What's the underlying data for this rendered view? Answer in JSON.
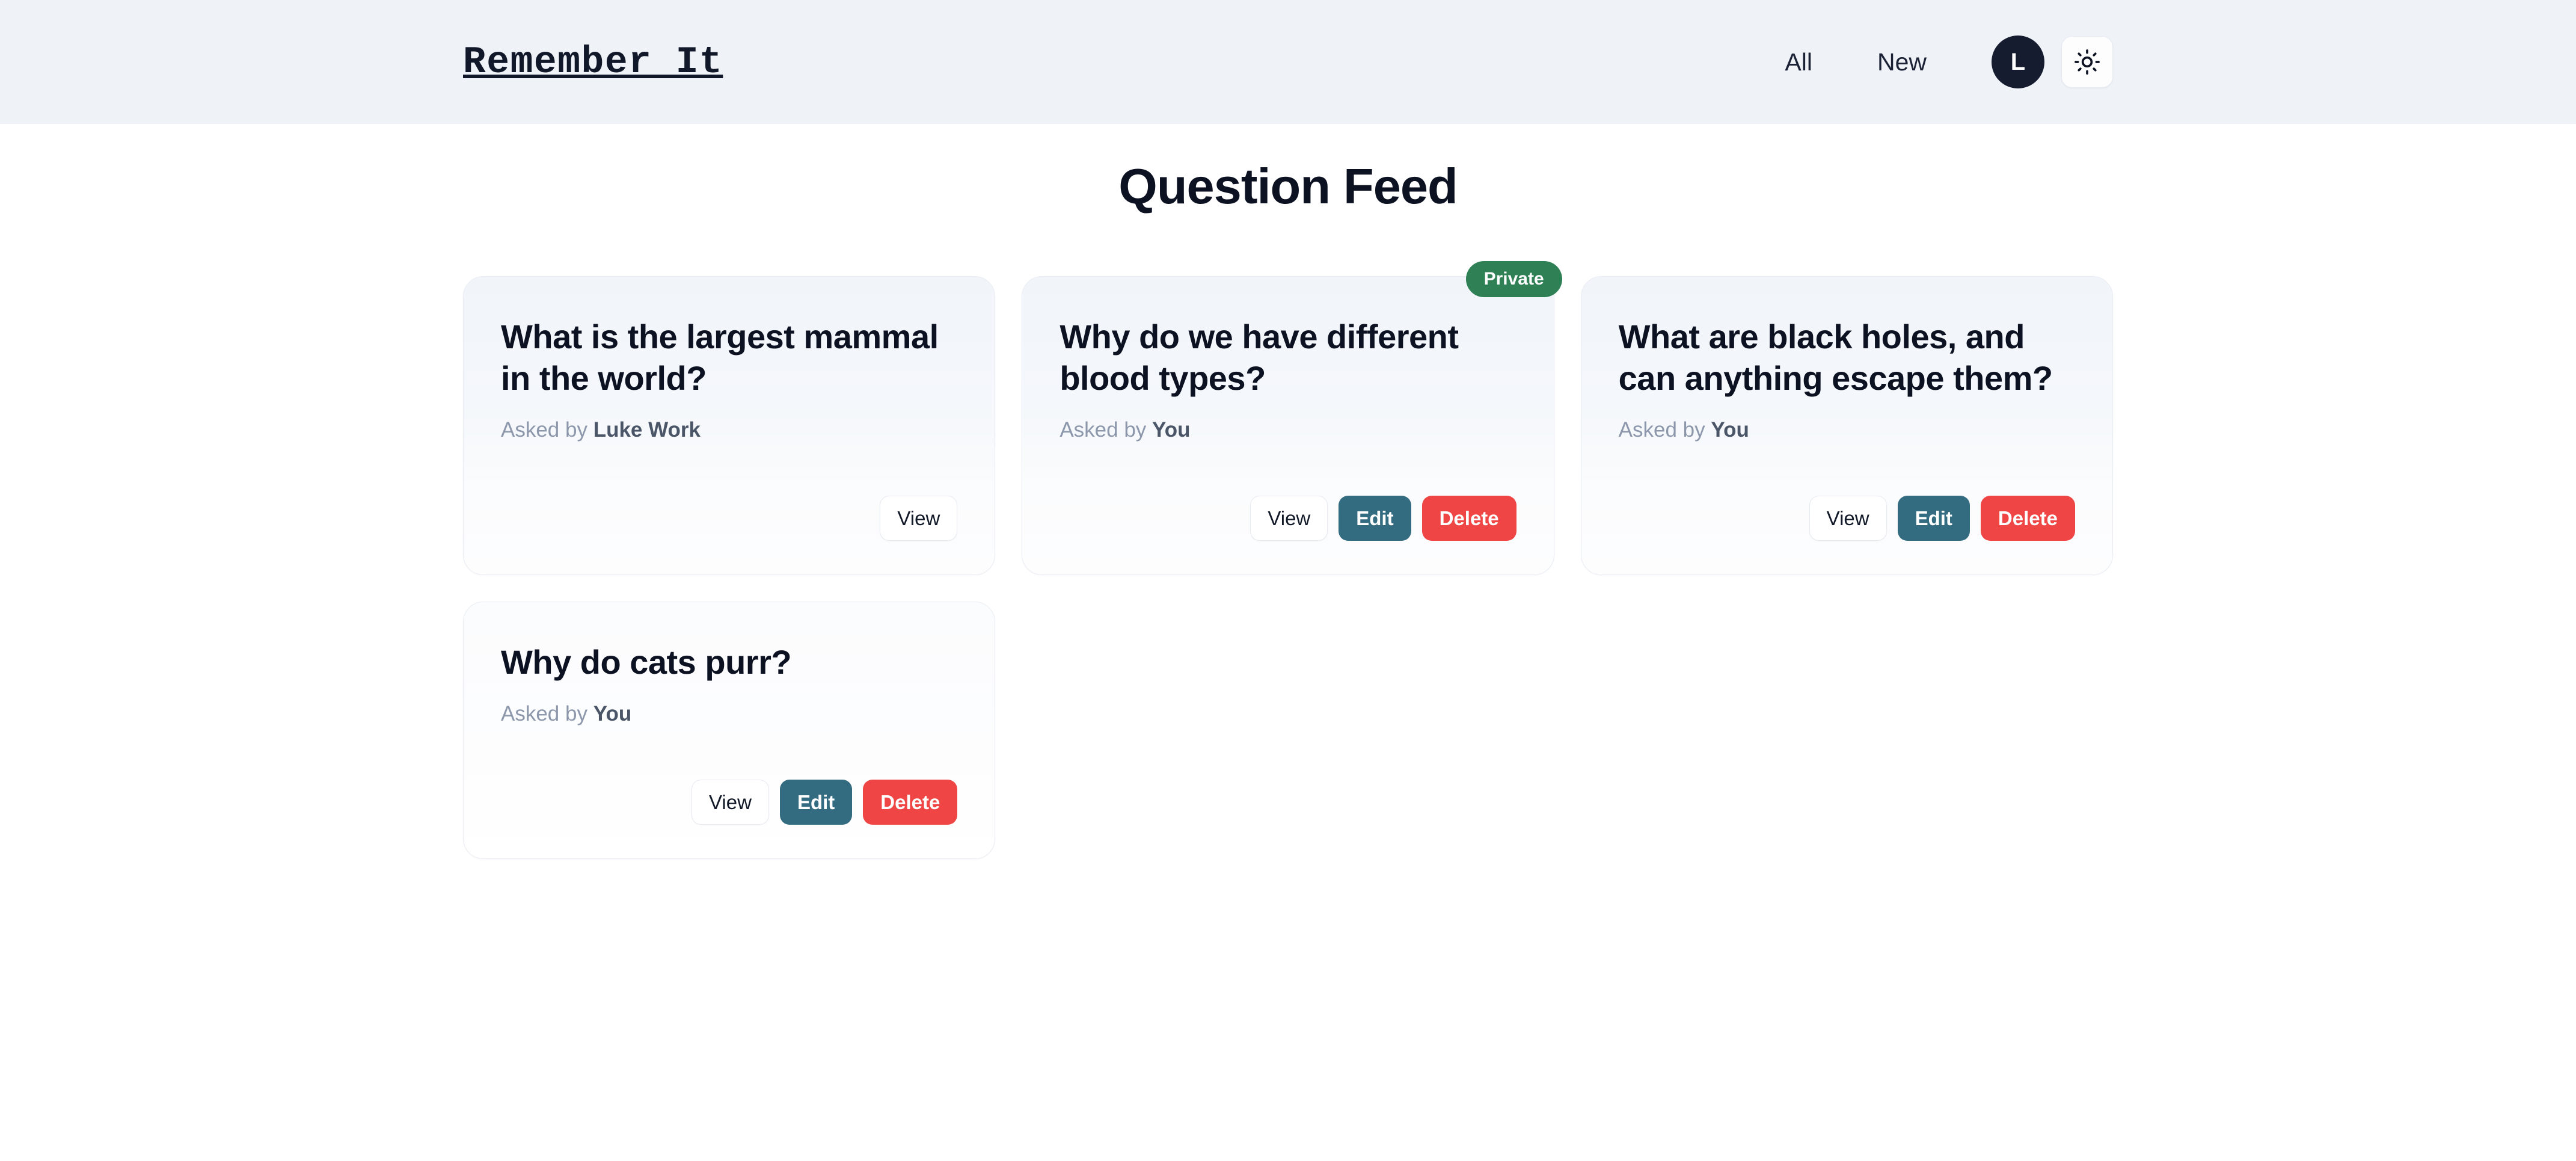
{
  "header": {
    "brand": "Remember It",
    "nav": [
      {
        "label": "All",
        "name": "nav-all"
      },
      {
        "label": "New",
        "name": "nav-new"
      }
    ],
    "avatar_initial": "L",
    "theme_toggle_icon": "sun-icon",
    "background_color": "#eff2f7"
  },
  "main": {
    "page_title": "Question Feed"
  },
  "colors": {
    "edit_button": "#336b80",
    "delete_button": "#ef4545",
    "private_badge": "#2f8055",
    "avatar": "#161c2f",
    "heading": "#0d1222"
  },
  "labels": {
    "asked_by_prefix": "Asked by",
    "view": "View",
    "edit": "Edit",
    "delete": "Delete",
    "private": "Private"
  },
  "cards": [
    {
      "title": "What is the largest mammal in the world?",
      "asked_by_prefix": "Asked by",
      "author": "Luke Work",
      "private": false,
      "badge": "",
      "actions": [
        "View"
      ]
    },
    {
      "title": "Why do we have different blood types?",
      "asked_by_prefix": "Asked by",
      "author": "You",
      "private": true,
      "badge": "Private",
      "actions": [
        "View",
        "Edit",
        "Delete"
      ]
    },
    {
      "title": "What are black holes, and can anything escape them?",
      "asked_by_prefix": "Asked by",
      "author": "You",
      "private": false,
      "badge": "",
      "actions": [
        "View",
        "Edit",
        "Delete"
      ]
    },
    {
      "title": "Why do cats purr?",
      "asked_by_prefix": "Asked by",
      "author": "You",
      "private": false,
      "badge": "",
      "actions": [
        "View",
        "Edit",
        "Delete"
      ]
    }
  ]
}
